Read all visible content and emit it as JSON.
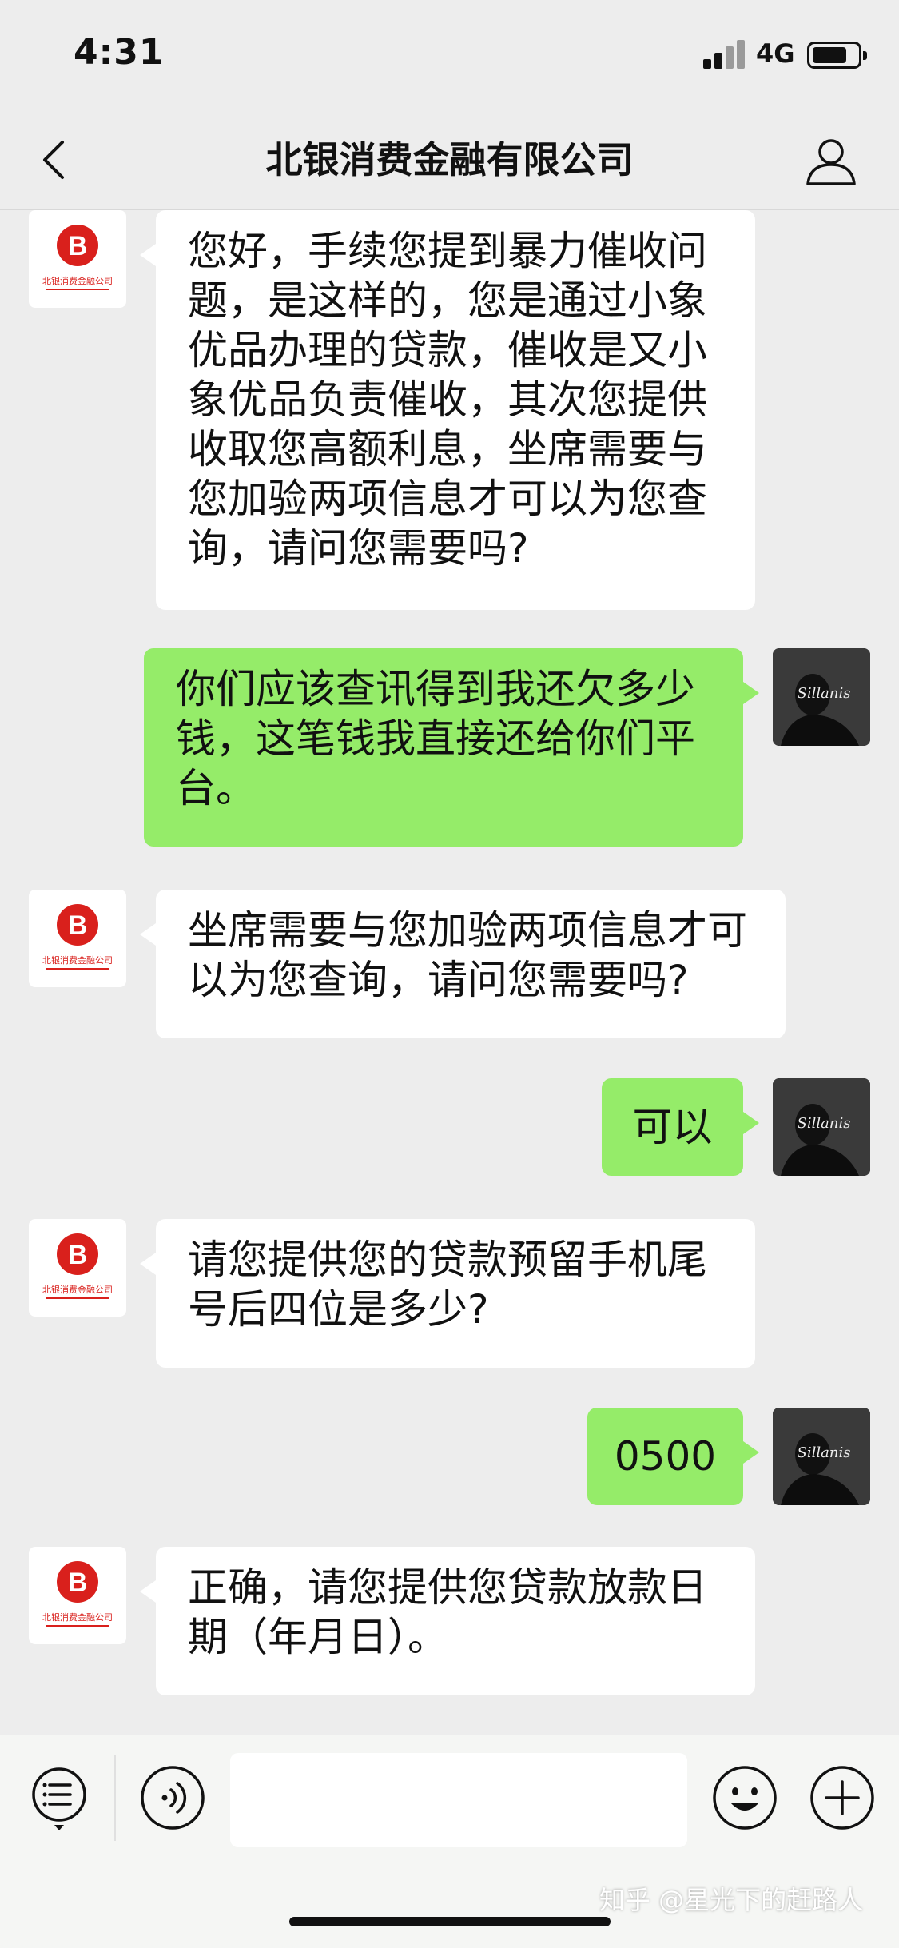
{
  "status_bar": {
    "time": "4:31",
    "network": "4G"
  },
  "nav": {
    "title": "北银消费金融有限公司"
  },
  "messages": [
    {
      "from": "bank",
      "text": "您好，手续您提到暴力催收问题，是这样的，您是通过小象优品办理的贷款，催收是又小象优品负责催收，其次您提供收取您高额利息，坐席需要与您加验两项信息才可以为您查询，请问您需要吗?"
    },
    {
      "from": "me",
      "text": "你们应该查讯得到我还欠多少钱，这笔钱我直接还给你们平台。"
    },
    {
      "from": "bank",
      "text": "坐席需要与您加验两项信息才可以为您查询，请问您需要吗?"
    },
    {
      "from": "me",
      "text": "可以"
    },
    {
      "from": "bank",
      "text": "请您提供您的贷款预留手机尾号后四位是多少?"
    },
    {
      "from": "me",
      "text": "0500"
    },
    {
      "from": "bank",
      "text": "正确，请您提供您贷款放款日期（年月日）。"
    }
  ],
  "bank_avatar": {
    "logo_text": "北银消费金融公司",
    "brand_color": "#d9201c"
  },
  "user_avatar": {
    "signature_text": "Sillanis"
  },
  "input_bar": {
    "placeholder": ""
  },
  "icons": [
    "back-icon",
    "profile-icon",
    "menu-icon",
    "voice-icon",
    "emoji-icon",
    "plus-icon"
  ],
  "colors": {
    "background": "#ededed",
    "incoming_bubble": "#ffffff",
    "outgoing_bubble": "#95ec69"
  },
  "watermark": "知乎 @星光下的赶路人"
}
